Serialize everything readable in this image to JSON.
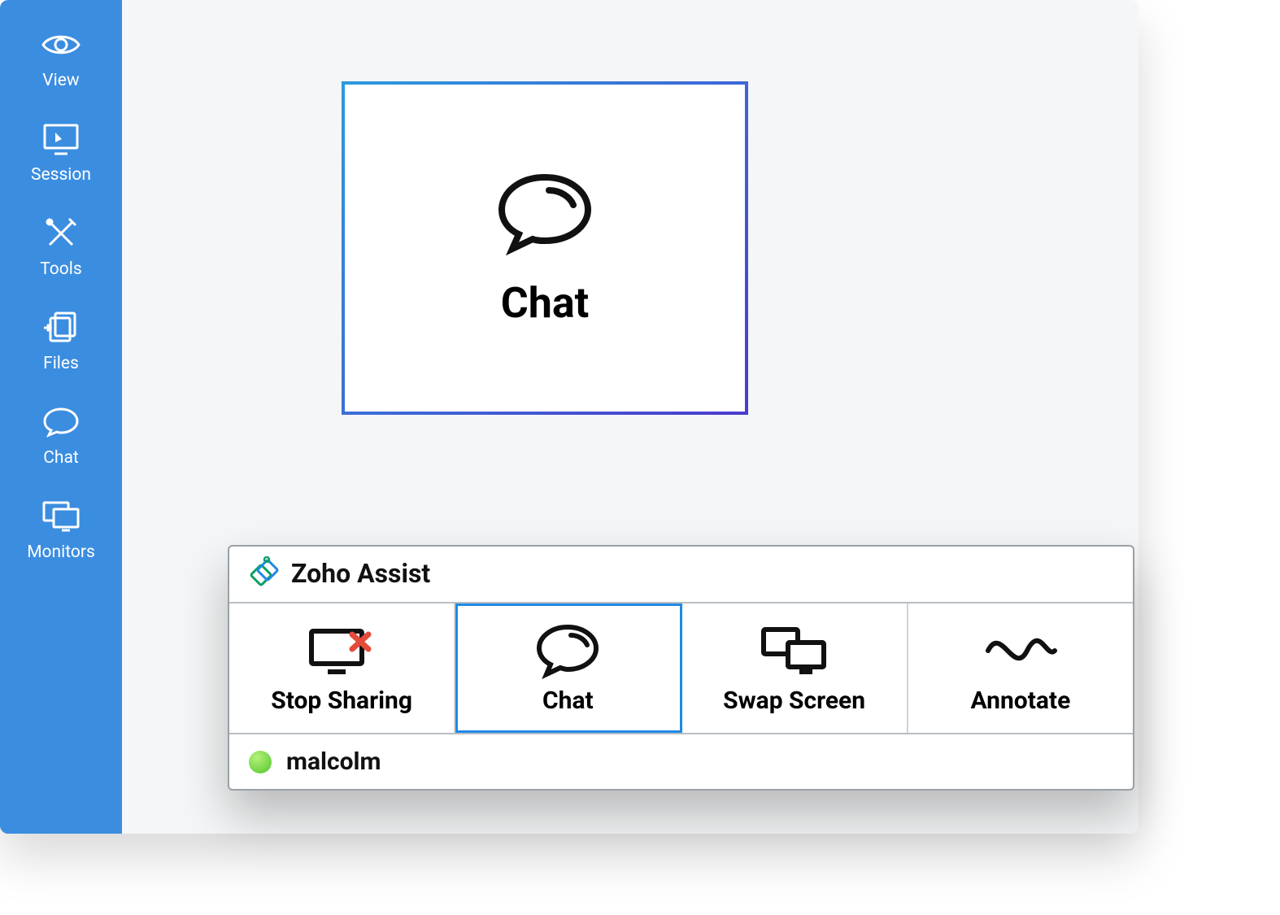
{
  "sidebar": {
    "items": [
      {
        "label": "View"
      },
      {
        "label": "Session"
      },
      {
        "label": "Tools"
      },
      {
        "label": "Files"
      },
      {
        "label": "Chat"
      },
      {
        "label": "Monitors"
      }
    ]
  },
  "card": {
    "label": "Chat"
  },
  "toolbar": {
    "title": "Zoho Assist",
    "buttons": [
      {
        "label": "Stop Sharing"
      },
      {
        "label": "Chat"
      },
      {
        "label": "Swap Screen"
      },
      {
        "label": "Annotate"
      }
    ],
    "user": "malcolm",
    "status_color": "#4fc52b"
  }
}
